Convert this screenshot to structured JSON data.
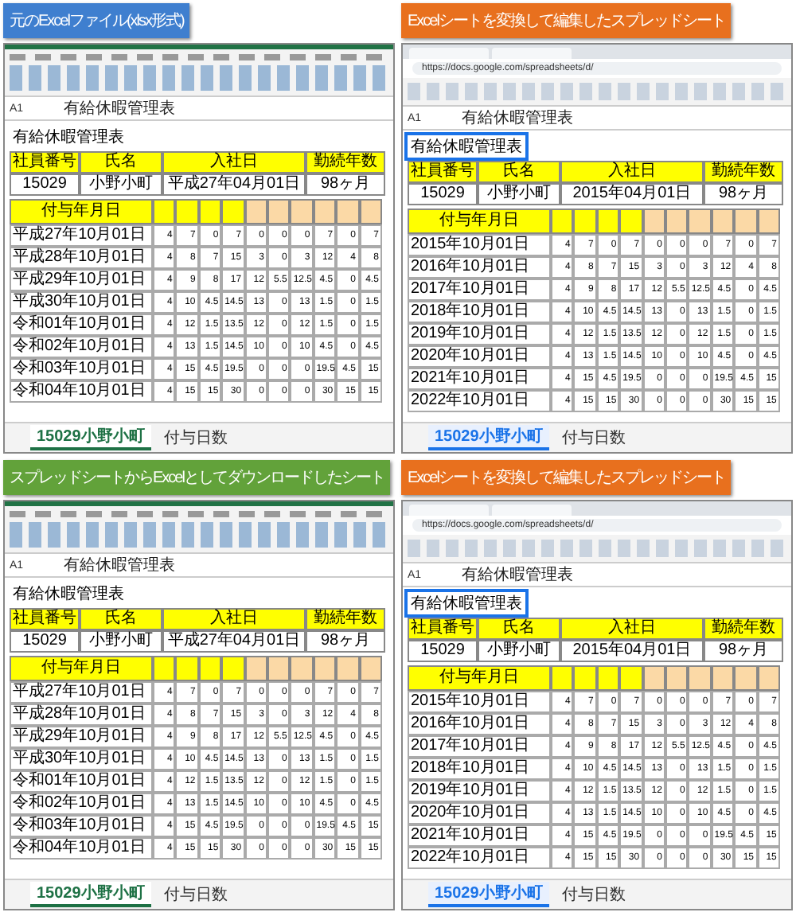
{
  "panels": [
    {
      "kind": "excel",
      "banner": {
        "text": "元のExcelファイル(xlsx形式)",
        "color": "#3f7fcf"
      },
      "formula": {
        "cell": "A1",
        "text": "有給休暇管理表"
      },
      "title": "有給休暇管理表",
      "info": {
        "headers": [
          "社員番号",
          "氏名",
          "入社日",
          "勤続年数"
        ],
        "values": [
          "15029",
          "小野小町",
          "平成27年04月01日",
          "98ヶ月"
        ]
      },
      "table": {
        "date_header": "付与年月日",
        "rows": [
          {
            "date": "平成27年10月01日",
            "values": [
              "4",
              "7",
              "0",
              "7",
              "0",
              "0",
              "0",
              "7",
              "0",
              "7"
            ]
          },
          {
            "date": "平成28年10月01日",
            "values": [
              "4",
              "8",
              "7",
              "15",
              "3",
              "0",
              "3",
              "12",
              "4",
              "8"
            ]
          },
          {
            "date": "平成29年10月01日",
            "values": [
              "4",
              "9",
              "8",
              "17",
              "12",
              "5.5",
              "12.5",
              "4.5",
              "0",
              "4.5"
            ]
          },
          {
            "date": "平成30年10月01日",
            "values": [
              "4",
              "10",
              "4.5",
              "14.5",
              "13",
              "0",
              "13",
              "1.5",
              "0",
              "1.5"
            ]
          },
          {
            "date": "令和01年10月01日",
            "values": [
              "4",
              "12",
              "1.5",
              "13.5",
              "12",
              "0",
              "12",
              "1.5",
              "0",
              "1.5"
            ]
          },
          {
            "date": "令和02年10月01日",
            "values": [
              "4",
              "13",
              "1.5",
              "14.5",
              "10",
              "0",
              "10",
              "4.5",
              "0",
              "4.5"
            ]
          },
          {
            "date": "令和03年10月01日",
            "values": [
              "4",
              "15",
              "4.5",
              "19.5",
              "0",
              "0",
              "0",
              "19.5",
              "4.5",
              "15"
            ]
          },
          {
            "date": "令和04年10月01日",
            "values": [
              "4",
              "15",
              "15",
              "30",
              "0",
              "0",
              "0",
              "30",
              "15",
              "15"
            ]
          }
        ]
      },
      "sheet_tabs": [
        {
          "label": "15029小野小町",
          "selected": true
        },
        {
          "label": "付与日数",
          "selected": false
        }
      ]
    },
    {
      "kind": "sheets",
      "banner": {
        "text": "Excelシートを変換して編集したスプレッドシート",
        "color": "#e8701e"
      },
      "url": "https://docs.google.com/spreadsheets/d/",
      "formula": {
        "cell": "A1",
        "text": "有給休暇管理表"
      },
      "title": "有給休暇管理表",
      "info": {
        "headers": [
          "社員番号",
          "氏名",
          "入社日",
          "勤続年数"
        ],
        "values": [
          "15029",
          "小野小町",
          "2015年04月01日",
          "98ヶ月"
        ]
      },
      "table": {
        "date_header": "付与年月日",
        "rows": [
          {
            "date": "2015年10月01日",
            "values": [
              "4",
              "7",
              "0",
              "7",
              "0",
              "0",
              "0",
              "7",
              "0",
              "7"
            ]
          },
          {
            "date": "2016年10月01日",
            "values": [
              "4",
              "8",
              "7",
              "15",
              "3",
              "0",
              "3",
              "12",
              "4",
              "8"
            ]
          },
          {
            "date": "2017年10月01日",
            "values": [
              "4",
              "9",
              "8",
              "17",
              "12",
              "5.5",
              "12.5",
              "4.5",
              "0",
              "4.5"
            ]
          },
          {
            "date": "2018年10月01日",
            "values": [
              "4",
              "10",
              "4.5",
              "14.5",
              "13",
              "0",
              "13",
              "1.5",
              "0",
              "1.5"
            ]
          },
          {
            "date": "2019年10月01日",
            "values": [
              "4",
              "12",
              "1.5",
              "13.5",
              "12",
              "0",
              "12",
              "1.5",
              "0",
              "1.5"
            ]
          },
          {
            "date": "2020年10月01日",
            "values": [
              "4",
              "13",
              "1.5",
              "14.5",
              "10",
              "0",
              "10",
              "4.5",
              "0",
              "4.5"
            ]
          },
          {
            "date": "2021年10月01日",
            "values": [
              "4",
              "15",
              "4.5",
              "19.5",
              "0",
              "0",
              "0",
              "19.5",
              "4.5",
              "15"
            ]
          },
          {
            "date": "2022年10月01日",
            "values": [
              "4",
              "15",
              "15",
              "30",
              "0",
              "0",
              "0",
              "30",
              "15",
              "15"
            ]
          }
        ]
      },
      "sheet_tabs": [
        {
          "label": "15029小野小町",
          "selected": true
        },
        {
          "label": "付与日数",
          "selected": false
        }
      ]
    },
    {
      "kind": "excel",
      "banner": {
        "text": "スプレッドシートからExcelとしてダウンロードしたシート",
        "color": "#62a23a"
      },
      "formula": {
        "cell": "A1",
        "text": "有給休暇管理表"
      },
      "title": "有給休暇管理表",
      "info": {
        "headers": [
          "社員番号",
          "氏名",
          "入社日",
          "勤続年数"
        ],
        "values": [
          "15029",
          "小野小町",
          "平成27年04月01日",
          "98ヶ月"
        ]
      },
      "table": {
        "date_header": "付与年月日",
        "rows": [
          {
            "date": "平成27年10月01日",
            "values": [
              "4",
              "7",
              "0",
              "7",
              "0",
              "0",
              "0",
              "7",
              "0",
              "7"
            ]
          },
          {
            "date": "平成28年10月01日",
            "values": [
              "4",
              "8",
              "7",
              "15",
              "3",
              "0",
              "3",
              "12",
              "4",
              "8"
            ]
          },
          {
            "date": "平成29年10月01日",
            "values": [
              "4",
              "9",
              "8",
              "17",
              "12",
              "5.5",
              "12.5",
              "4.5",
              "0",
              "4.5"
            ]
          },
          {
            "date": "平成30年10月01日",
            "values": [
              "4",
              "10",
              "4.5",
              "14.5",
              "13",
              "0",
              "13",
              "1.5",
              "0",
              "1.5"
            ]
          },
          {
            "date": "令和01年10月01日",
            "values": [
              "4",
              "12",
              "1.5",
              "13.5",
              "12",
              "0",
              "12",
              "1.5",
              "0",
              "1.5"
            ]
          },
          {
            "date": "令和02年10月01日",
            "values": [
              "4",
              "13",
              "1.5",
              "14.5",
              "10",
              "0",
              "10",
              "4.5",
              "0",
              "4.5"
            ]
          },
          {
            "date": "令和03年10月01日",
            "values": [
              "4",
              "15",
              "4.5",
              "19.5",
              "0",
              "0",
              "0",
              "19.5",
              "4.5",
              "15"
            ]
          },
          {
            "date": "令和04年10月01日",
            "values": [
              "4",
              "15",
              "15",
              "30",
              "0",
              "0",
              "0",
              "30",
              "15",
              "15"
            ]
          }
        ]
      },
      "sheet_tabs": [
        {
          "label": "15029小野小町",
          "selected": true
        },
        {
          "label": "付与日数",
          "selected": false
        }
      ]
    },
    {
      "kind": "sheets",
      "banner": {
        "text": "Excelシートを変換して編集したスプレッドシート",
        "color": "#e8701e"
      },
      "url": "https://docs.google.com/spreadsheets/d/",
      "formula": {
        "cell": "A1",
        "text": "有給休暇管理表"
      },
      "title": "有給休暇管理表",
      "info": {
        "headers": [
          "社員番号",
          "氏名",
          "入社日",
          "勤続年数"
        ],
        "values": [
          "15029",
          "小野小町",
          "2015年04月01日",
          "98ヶ月"
        ]
      },
      "table": {
        "date_header": "付与年月日",
        "rows": [
          {
            "date": "2015年10月01日",
            "values": [
              "4",
              "7",
              "0",
              "7",
              "0",
              "0",
              "0",
              "7",
              "0",
              "7"
            ]
          },
          {
            "date": "2016年10月01日",
            "values": [
              "4",
              "8",
              "7",
              "15",
              "3",
              "0",
              "3",
              "12",
              "4",
              "8"
            ]
          },
          {
            "date": "2017年10月01日",
            "values": [
              "4",
              "9",
              "8",
              "17",
              "12",
              "5.5",
              "12.5",
              "4.5",
              "0",
              "4.5"
            ]
          },
          {
            "date": "2018年10月01日",
            "values": [
              "4",
              "10",
              "4.5",
              "14.5",
              "13",
              "0",
              "13",
              "1.5",
              "0",
              "1.5"
            ]
          },
          {
            "date": "2019年10月01日",
            "values": [
              "4",
              "12",
              "1.5",
              "13.5",
              "12",
              "0",
              "12",
              "1.5",
              "0",
              "1.5"
            ]
          },
          {
            "date": "2020年10月01日",
            "values": [
              "4",
              "13",
              "1.5",
              "14.5",
              "10",
              "0",
              "10",
              "4.5",
              "0",
              "4.5"
            ]
          },
          {
            "date": "2021年10月01日",
            "values": [
              "4",
              "15",
              "4.5",
              "19.5",
              "0",
              "0",
              "0",
              "19.5",
              "4.5",
              "15"
            ]
          },
          {
            "date": "2022年10月01日",
            "values": [
              "4",
              "15",
              "15",
              "30",
              "0",
              "0",
              "0",
              "30",
              "15",
              "15"
            ]
          }
        ]
      },
      "sheet_tabs": [
        {
          "label": "15029小野小町",
          "selected": true
        },
        {
          "label": "付与日数",
          "selected": false
        }
      ]
    }
  ]
}
